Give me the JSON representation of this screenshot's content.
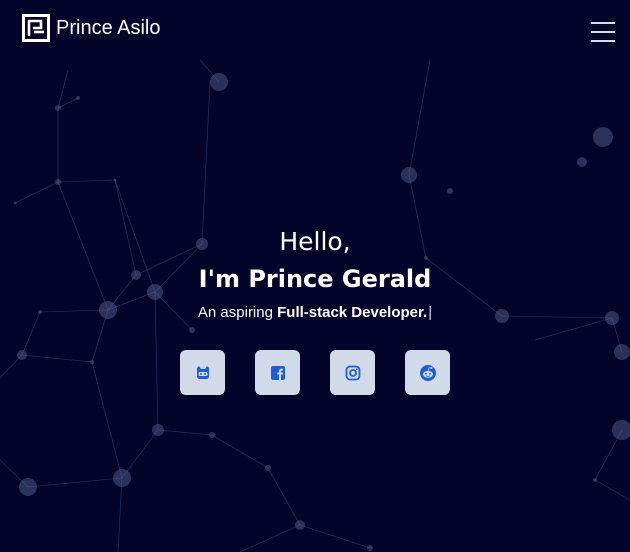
{
  "navbar": {
    "brand_name": "Prince Asilo",
    "logo_icon": "pa-monogram-logo",
    "menu_icon": "hamburger-menu-icon"
  },
  "hero": {
    "greeting": "Hello,",
    "name_line": "I'm Prince Gerald",
    "tagline_prefix": "An aspiring",
    "tagline_role": "Full-stack Developer.",
    "cursor": "|"
  },
  "socials": [
    {
      "icon": "github-icon"
    },
    {
      "icon": "facebook-icon"
    },
    {
      "icon": "instagram-icon"
    },
    {
      "icon": "reddit-icon"
    }
  ],
  "colors": {
    "background": "#04032a",
    "social_button_bg": "#d2d9e8",
    "social_icon": "#1f5dd6",
    "network_line": "#3b4b7c"
  }
}
